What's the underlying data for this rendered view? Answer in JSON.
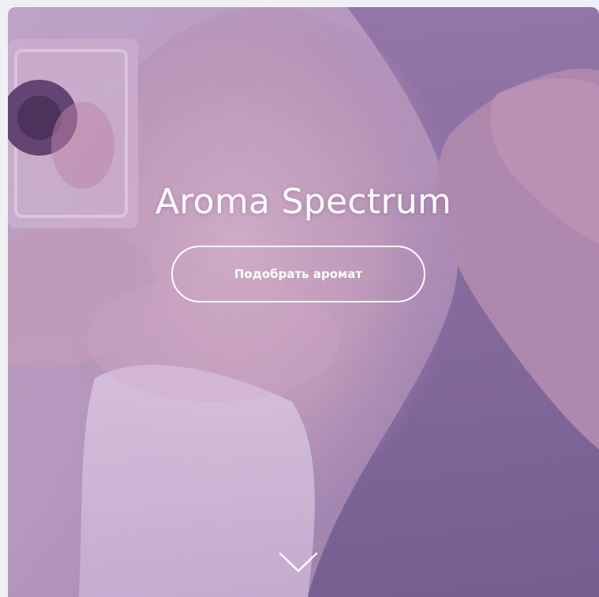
{
  "hero": {
    "title": "Aroma Spectrum",
    "cta_label": "Подобрать аромат",
    "scroll_icon": "chevron-down-icon"
  },
  "colors": {
    "page_background": "#eef0f4",
    "overlay_tint": "#b79ac1",
    "text": "#ffffff"
  }
}
